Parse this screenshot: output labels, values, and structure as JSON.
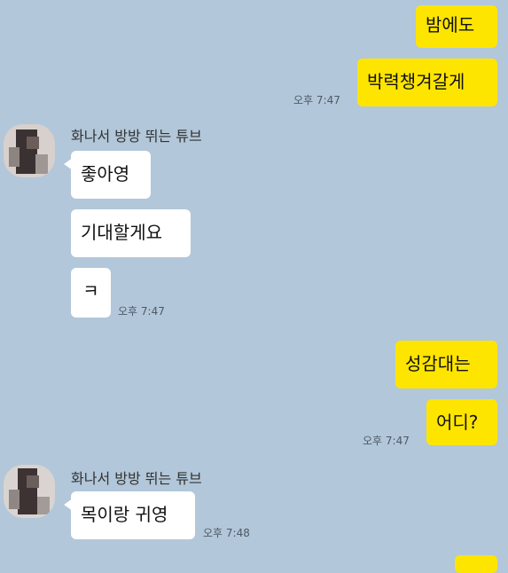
{
  "chat": {
    "sender_name": "화나서 방방 뛰는 튜브",
    "messages": {
      "m1": "밤에도",
      "m2": "박력챙겨갈게",
      "m3": "좋아영",
      "m4": "기대할게요",
      "m5": "ㅋ",
      "m6": "성감대는",
      "m7": "어디?",
      "m8": "목이랑 귀영"
    },
    "times": {
      "t1": "오후 7:47",
      "t2": "오후 7:47",
      "t3": "오후 7:47",
      "t4": "오후 7:48"
    }
  },
  "colors": {
    "background": "#b2c7d9",
    "my_bubble": "#fee500",
    "their_bubble": "#ffffff"
  }
}
